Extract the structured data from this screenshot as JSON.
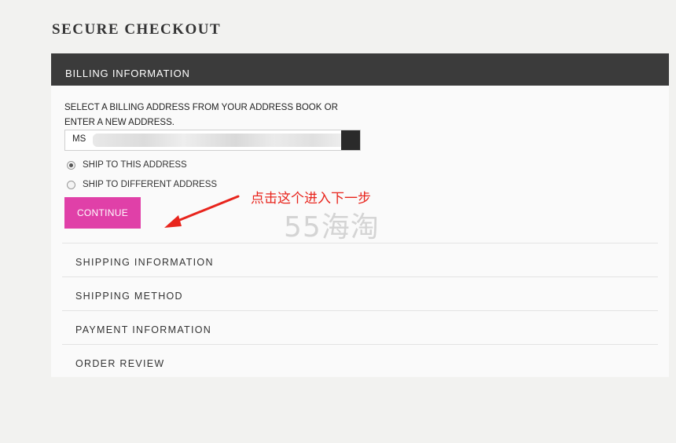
{
  "page": {
    "title": "SECURE CHECKOUT"
  },
  "billing": {
    "header": "BILLING INFORMATION",
    "instructions_line1": "SELECT A BILLING ADDRESS FROM YOUR ADDRESS BOOK OR",
    "instructions_line2": "ENTER A NEW ADDRESS.",
    "address_value": "MS",
    "ship_options": [
      {
        "label": "SHIP TO THIS ADDRESS",
        "checked": true
      },
      {
        "label": "SHIP TO DIFFERENT ADDRESS",
        "checked": false
      }
    ],
    "continue_label": "CONTINUE"
  },
  "annotation": {
    "text": "点击这个进入下一步",
    "color": "#e8241c"
  },
  "watermark": {
    "text": "55海淘"
  },
  "steps": [
    {
      "label": "SHIPPING INFORMATION"
    },
    {
      "label": "SHIPPING METHOD"
    },
    {
      "label": "PAYMENT INFORMATION"
    },
    {
      "label": "ORDER REVIEW"
    }
  ],
  "colors": {
    "accent": "#e040a8",
    "header_bg": "#3b3b3b"
  }
}
